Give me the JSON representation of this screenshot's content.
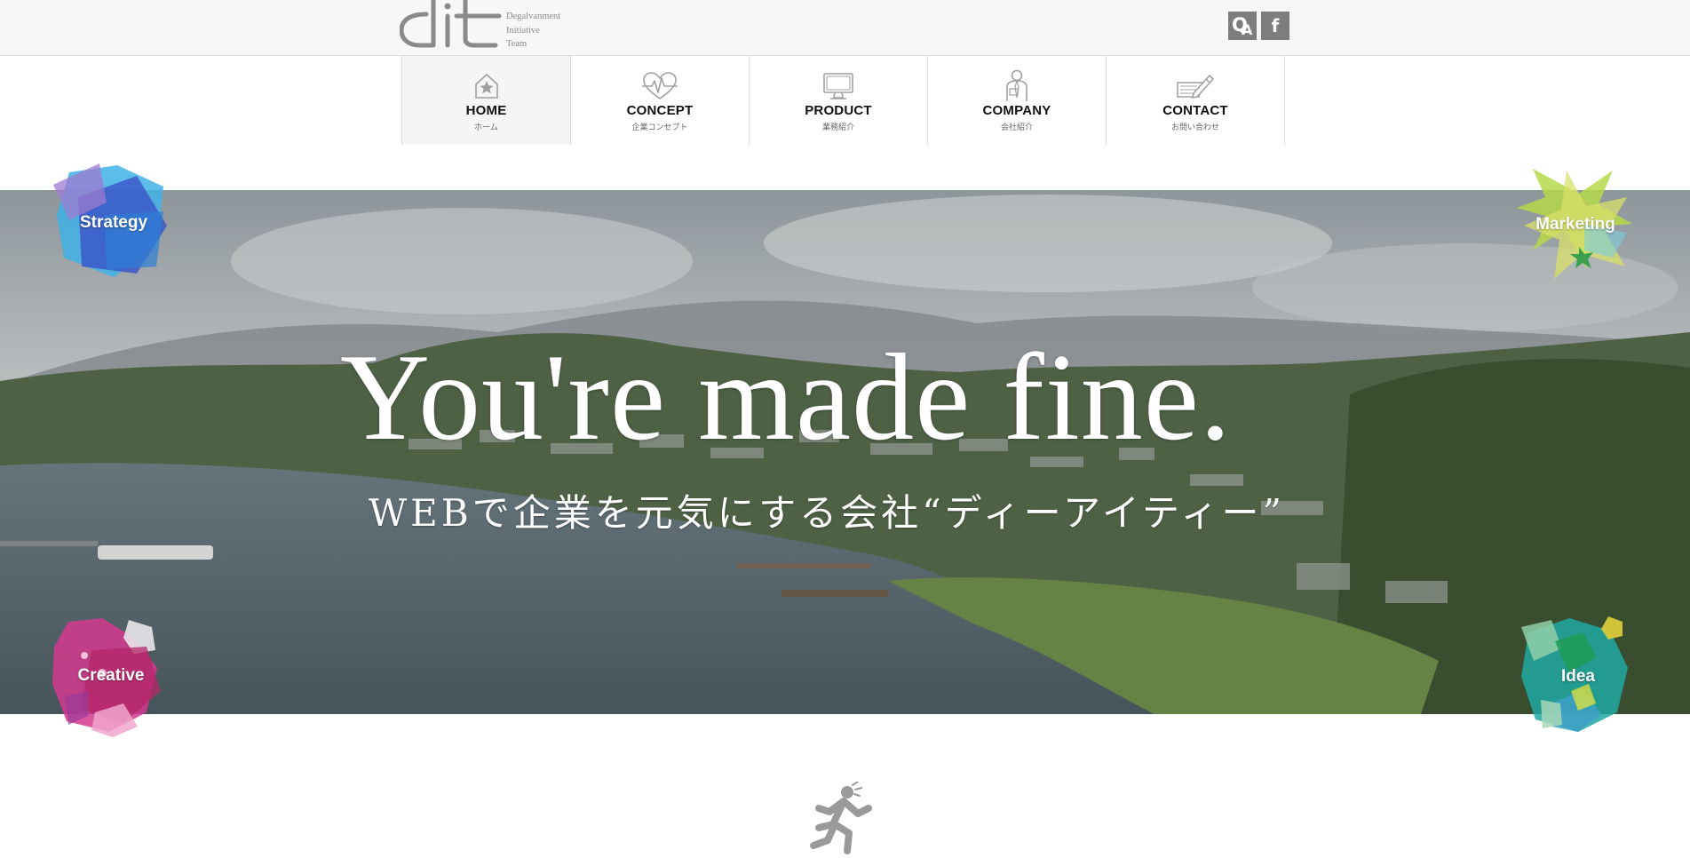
{
  "logo": {
    "mark": "dit",
    "lines": [
      "Degalvanment",
      "Initiative",
      "Team"
    ]
  },
  "social": [
    {
      "name": "qa-icon",
      "q": "Q",
      "a": "A"
    },
    {
      "name": "facebook-icon",
      "label": "f"
    }
  ],
  "nav": [
    {
      "label": "HOME",
      "sub": "ホーム",
      "icon": "home-star-icon",
      "active": true
    },
    {
      "label": "CONCEPT",
      "sub": "企業コンセプト",
      "icon": "heartbeat-icon",
      "active": false
    },
    {
      "label": "PRODUCT",
      "sub": "業務紹介",
      "icon": "monitor-icon",
      "active": false
    },
    {
      "label": "COMPANY",
      "sub": "会社紹介",
      "icon": "person-icon",
      "active": false
    },
    {
      "label": "CONTACT",
      "sub": "お問い合わせ",
      "icon": "pen-letter-icon",
      "active": false
    }
  ],
  "hero": {
    "title": "You're made fine.",
    "subtitle": "WEBで企業を元気にする会社“ディーアイティー”"
  },
  "badges": {
    "strategy": "Strategy",
    "marketing": "Marketing",
    "creative": "Creative",
    "idea": "Idea"
  },
  "colors": {
    "topbar_bg": "#f6f7f7",
    "social_bg": "#7d7d7d",
    "nav_text": "#111111",
    "strategy": "#3a6fd8",
    "marketing": "#a8d44c",
    "creative": "#c2327e",
    "idea": "#1aa59b"
  }
}
